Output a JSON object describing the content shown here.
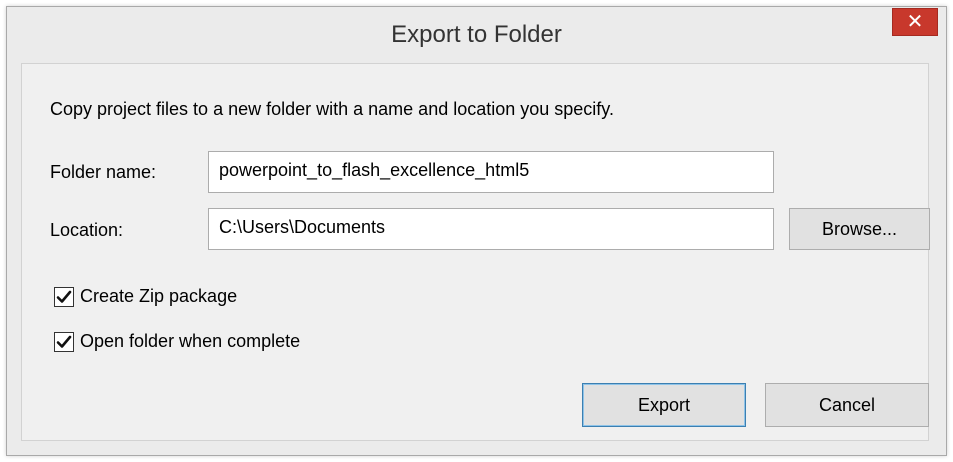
{
  "dialog": {
    "title": "Export to Folder",
    "close_glyph": "✕",
    "description": "Copy project files to a new folder with a name and location you specify.",
    "folder_name": {
      "label": "Folder name:",
      "value": "powerpoint_to_flash_excellence_html5"
    },
    "location": {
      "label": "Location:",
      "value": "C:\\Users\\Documents",
      "browse_label": "Browse..."
    },
    "options": [
      {
        "label": "Create Zip package",
        "checked": true
      },
      {
        "label": "Open folder when complete",
        "checked": true
      }
    ],
    "export_label": "Export",
    "cancel_label": "Cancel"
  },
  "colors": {
    "close_button": "#c8382c",
    "window_bg": "#ebebeb",
    "client_bg": "#f0f0f0",
    "default_button_border": "#3c7fb1"
  },
  "icons": {
    "close": "close-icon",
    "check": "checkmark-icon"
  }
}
